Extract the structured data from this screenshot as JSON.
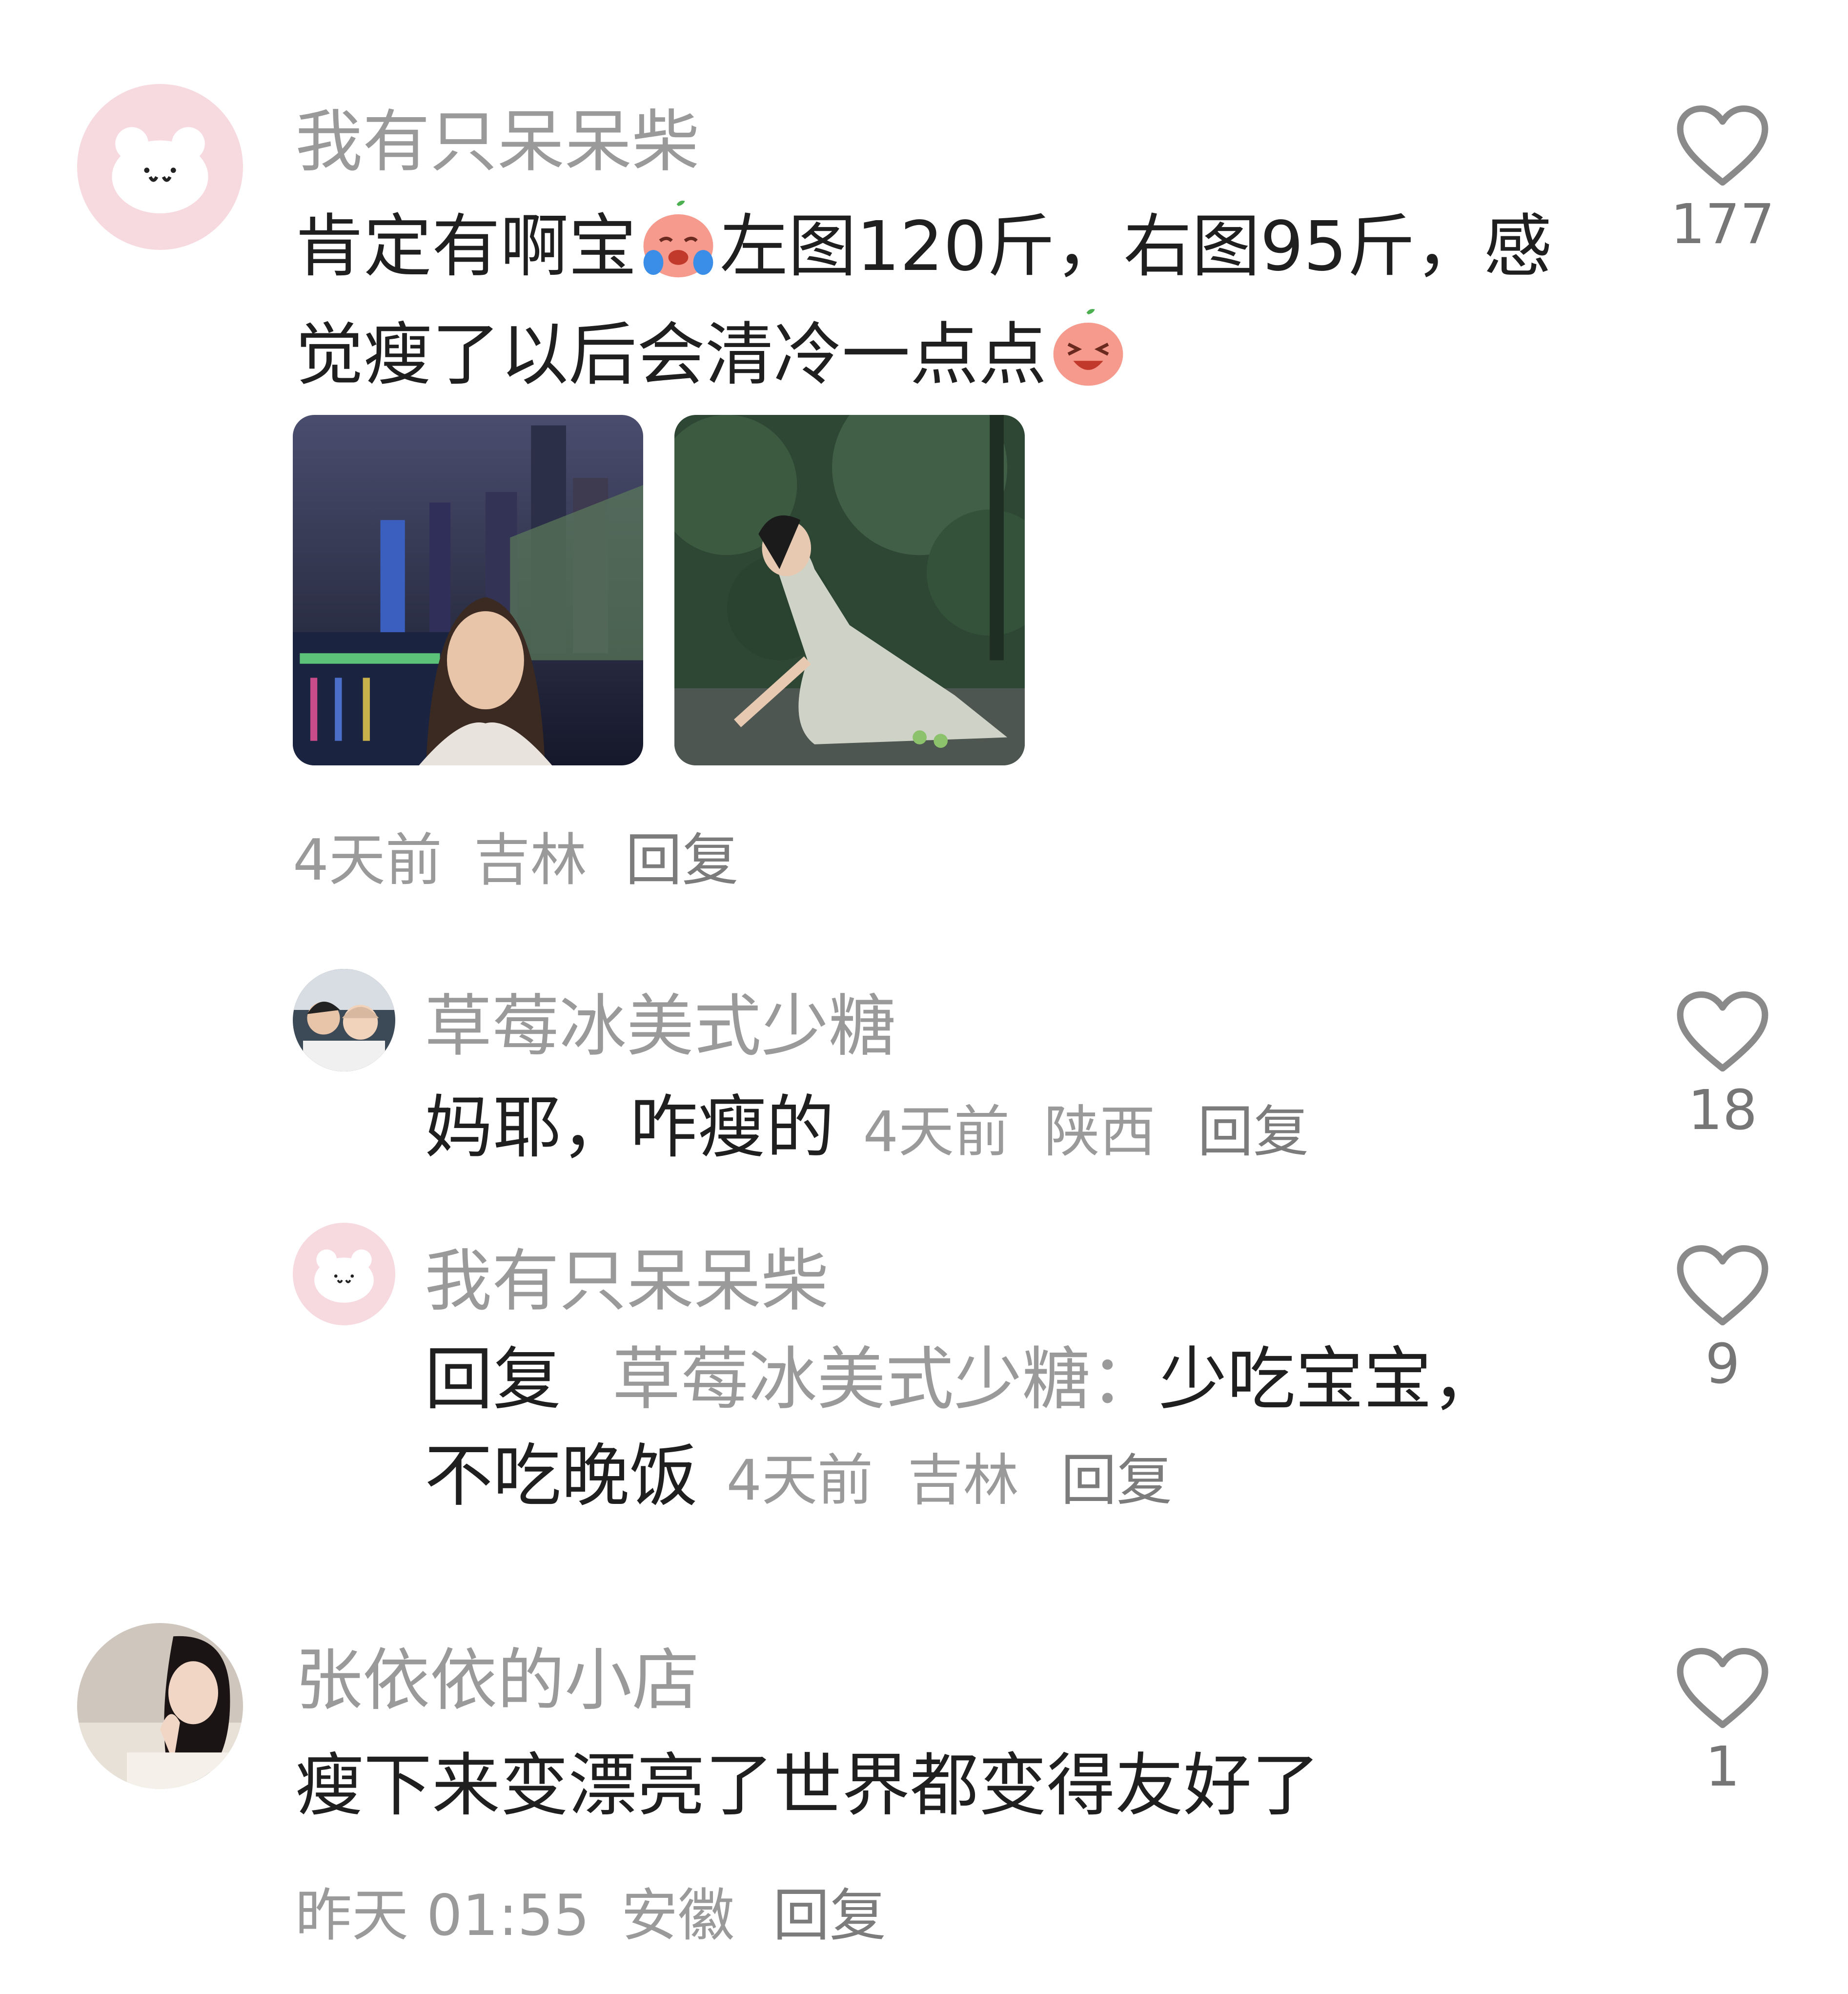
{
  "comments": [
    {
      "username": "我有只呆呆柴",
      "text_part1": "肯定有啊宝",
      "emoji1": "crying-face-emoji",
      "text_part2": "左图120斤，右图95斤，感觉瘦了以后会清冷一点点",
      "emoji2": "laughing-face-emoji",
      "images": [
        "photo-night-city-portrait",
        "photo-forest-sitting"
      ],
      "time": "4天前",
      "location": "吉林",
      "reply_label": "回复",
      "likes": "177",
      "replies": [
        {
          "username": "草莓冰美式少糖",
          "text": "妈耶，咋瘦的",
          "time": "4天前",
          "location": "陕西",
          "reply_label": "回复",
          "likes": "18"
        },
        {
          "username": "我有只呆呆柴",
          "reply_prefix": "回复",
          "reply_to": "草莓冰美式少糖：",
          "text": "少吃宝宝，不吃晚饭",
          "time": "4天前",
          "location": "吉林",
          "reply_label": "回复",
          "likes": "9"
        }
      ]
    },
    {
      "username": "张依依的小店",
      "text": "瘦下来变漂亮了世界都变得友好了",
      "time": "昨天 01:55",
      "location": "安徽",
      "reply_label": "回复",
      "likes": "1"
    }
  ],
  "colors": {
    "username": "#9a9a9a",
    "body": "#1f1f1f",
    "meta": "#9a9a9a",
    "avatar_pink": "#f7d9e0"
  }
}
